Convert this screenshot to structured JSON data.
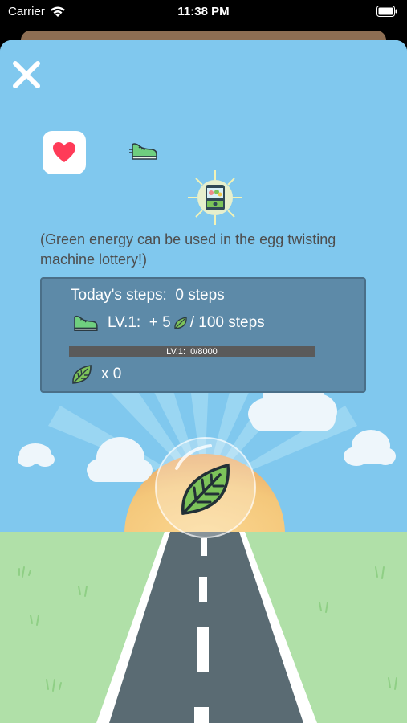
{
  "status_bar": {
    "carrier": "Carrier",
    "time": "11:38 PM"
  },
  "sheet": {
    "info_line1": "(Green energy can be used in the egg twisting",
    "info_line2": "machine lottery!)",
    "steps_label": "Today's steps:",
    "steps_value": "0 steps",
    "level_label": "LV.1:",
    "level_reward_prefix": "+ 5",
    "level_reward_suffix": "/ 100 steps",
    "progress_label": "LV.1:",
    "progress_value": "0/8000",
    "progress_fraction": 0,
    "energy_count": "x 0"
  },
  "icons": [
    "wifi-icon",
    "battery-icon",
    "close-icon",
    "heart-icon",
    "shoe-icon",
    "gashapon-icon",
    "leaf-icon"
  ],
  "colors": {
    "sky": "#80c8ee",
    "panel": "#5d8aa8",
    "grass": "#b0e0a8",
    "road": "#5a6b73",
    "leaf": "#7cc35a"
  }
}
